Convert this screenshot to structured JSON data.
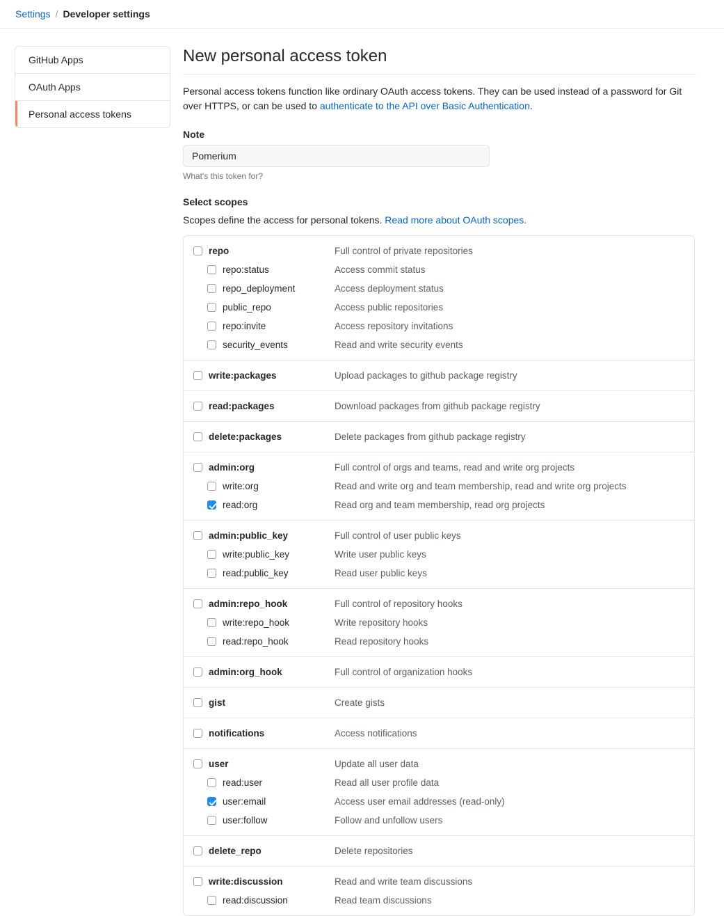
{
  "breadcrumb": {
    "root": "Settings",
    "separator": "/",
    "current": "Developer settings"
  },
  "sidebar": {
    "items": [
      {
        "label": "GitHub Apps",
        "active": false
      },
      {
        "label": "OAuth Apps",
        "active": false
      },
      {
        "label": "Personal access tokens",
        "active": true
      }
    ],
    "active_accent_color": "#f9826c"
  },
  "main": {
    "title": "New personal access token",
    "intro_before_link": "Personal access tokens function like ordinary OAuth access tokens. They can be used instead of a password for Git over HTTPS, or can be used to ",
    "intro_link": "authenticate to the API over Basic Authentication",
    "intro_after_link": ".",
    "note": {
      "label": "Note",
      "value": "Pomerium",
      "placeholder": "What's this token for?",
      "hint": "What's this token for?"
    },
    "scopes": {
      "heading": "Select scopes",
      "sub_before_link": "Scopes define the access for personal tokens. ",
      "sub_link": "Read more about OAuth scopes.",
      "link_color": "#0366d6"
    }
  },
  "scope_groups": [
    {
      "rows": [
        {
          "name": "repo",
          "desc": "Full control of private repositories",
          "checked": false,
          "child": false
        },
        {
          "name": "repo:status",
          "desc": "Access commit status",
          "checked": false,
          "child": true
        },
        {
          "name": "repo_deployment",
          "desc": "Access deployment status",
          "checked": false,
          "child": true
        },
        {
          "name": "public_repo",
          "desc": "Access public repositories",
          "checked": false,
          "child": true
        },
        {
          "name": "repo:invite",
          "desc": "Access repository invitations",
          "checked": false,
          "child": true
        },
        {
          "name": "security_events",
          "desc": "Read and write security events",
          "checked": false,
          "child": true
        }
      ]
    },
    {
      "rows": [
        {
          "name": "write:packages",
          "desc": "Upload packages to github package registry",
          "checked": false,
          "child": false
        }
      ]
    },
    {
      "rows": [
        {
          "name": "read:packages",
          "desc": "Download packages from github package registry",
          "checked": false,
          "child": false
        }
      ]
    },
    {
      "rows": [
        {
          "name": "delete:packages",
          "desc": "Delete packages from github package registry",
          "checked": false,
          "child": false
        }
      ]
    },
    {
      "rows": [
        {
          "name": "admin:org",
          "desc": "Full control of orgs and teams, read and write org projects",
          "checked": false,
          "child": false
        },
        {
          "name": "write:org",
          "desc": "Read and write org and team membership, read and write org projects",
          "checked": false,
          "child": true
        },
        {
          "name": "read:org",
          "desc": "Read org and team membership, read org projects",
          "checked": true,
          "child": true
        }
      ]
    },
    {
      "rows": [
        {
          "name": "admin:public_key",
          "desc": "Full control of user public keys",
          "checked": false,
          "child": false
        },
        {
          "name": "write:public_key",
          "desc": "Write user public keys",
          "checked": false,
          "child": true
        },
        {
          "name": "read:public_key",
          "desc": "Read user public keys",
          "checked": false,
          "child": true
        }
      ]
    },
    {
      "rows": [
        {
          "name": "admin:repo_hook",
          "desc": "Full control of repository hooks",
          "checked": false,
          "child": false
        },
        {
          "name": "write:repo_hook",
          "desc": "Write repository hooks",
          "checked": false,
          "child": true
        },
        {
          "name": "read:repo_hook",
          "desc": "Read repository hooks",
          "checked": false,
          "child": true
        }
      ]
    },
    {
      "rows": [
        {
          "name": "admin:org_hook",
          "desc": "Full control of organization hooks",
          "checked": false,
          "child": false
        }
      ]
    },
    {
      "rows": [
        {
          "name": "gist",
          "desc": "Create gists",
          "checked": false,
          "child": false
        }
      ]
    },
    {
      "rows": [
        {
          "name": "notifications",
          "desc": "Access notifications",
          "checked": false,
          "child": false
        }
      ]
    },
    {
      "rows": [
        {
          "name": "user",
          "desc": "Update all user data",
          "checked": false,
          "child": false
        },
        {
          "name": "read:user",
          "desc": "Read all user profile data",
          "checked": false,
          "child": true
        },
        {
          "name": "user:email",
          "desc": "Access user email addresses (read-only)",
          "checked": true,
          "child": true
        },
        {
          "name": "user:follow",
          "desc": "Follow and unfollow users",
          "checked": false,
          "child": true
        }
      ]
    },
    {
      "rows": [
        {
          "name": "delete_repo",
          "desc": "Delete repositories",
          "checked": false,
          "child": false
        }
      ]
    },
    {
      "rows": [
        {
          "name": "write:discussion",
          "desc": "Read and write team discussions",
          "checked": false,
          "child": false
        },
        {
          "name": "read:discussion",
          "desc": "Read team discussions",
          "checked": false,
          "child": true
        }
      ]
    }
  ]
}
